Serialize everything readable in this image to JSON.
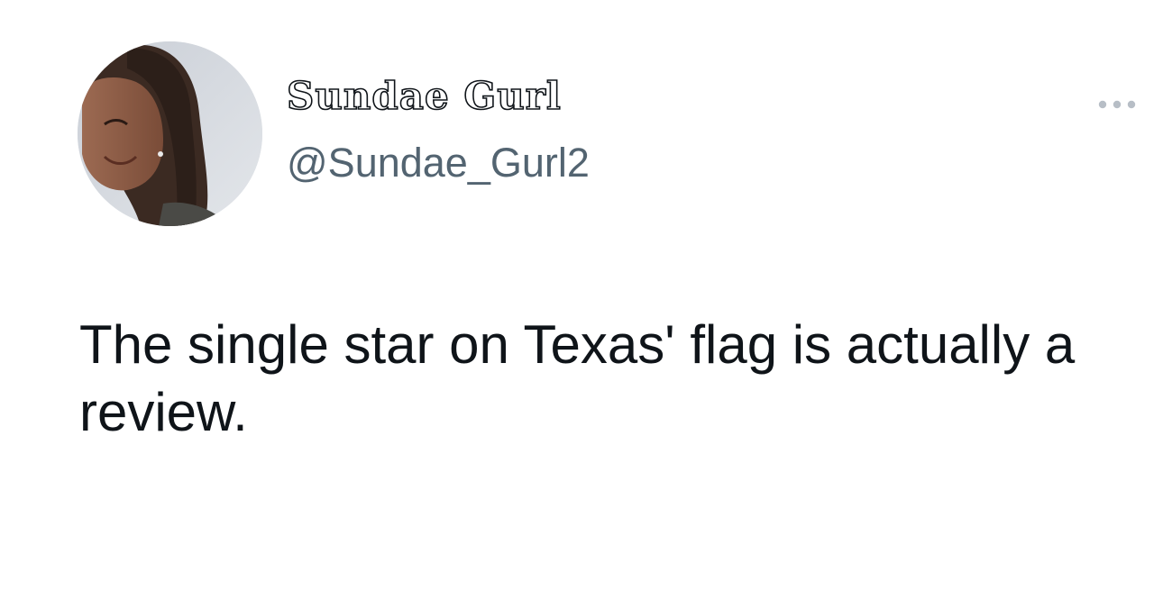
{
  "tweet": {
    "author": {
      "display_name": "Sundae Gurl",
      "handle": "@Sundae_Gurl2",
      "avatar_icon": "profile-photo"
    },
    "more_icon": "more-horizontal-icon",
    "text": "The single star on Texas' flag is actually a review."
  },
  "colors": {
    "text_primary": "#0f1419",
    "text_secondary": "#536471",
    "background": "#ffffff",
    "more_icon": "#b7bec6"
  }
}
